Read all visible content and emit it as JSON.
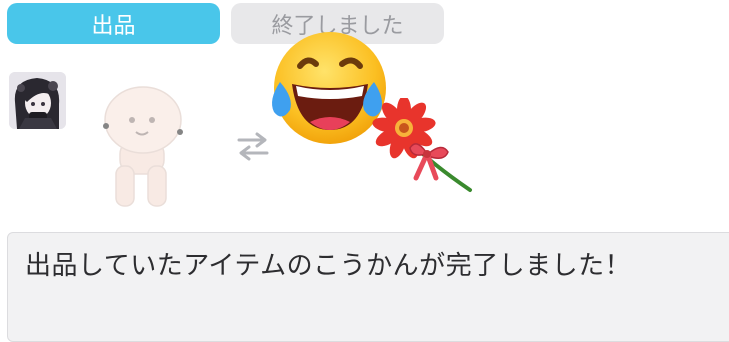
{
  "tabs": [
    {
      "label": "出品",
      "active": true
    },
    {
      "label": "終了しました",
      "active": false
    }
  ],
  "trade": {
    "left_item": "doll-base",
    "swap_icon": "swap-arrows-icon",
    "right_items": [
      "face-with-tears-of-joy-emoji",
      "red-flower-with-ribbon"
    ]
  },
  "message": {
    "text": "出品していたアイテムのこうかんが完了しました！"
  },
  "colors": {
    "accent": "#49c6ea",
    "inactive_tab": "#e8e8ea",
    "inactive_text": "#9a9ba0",
    "message_bg": "#f2f2f3"
  }
}
